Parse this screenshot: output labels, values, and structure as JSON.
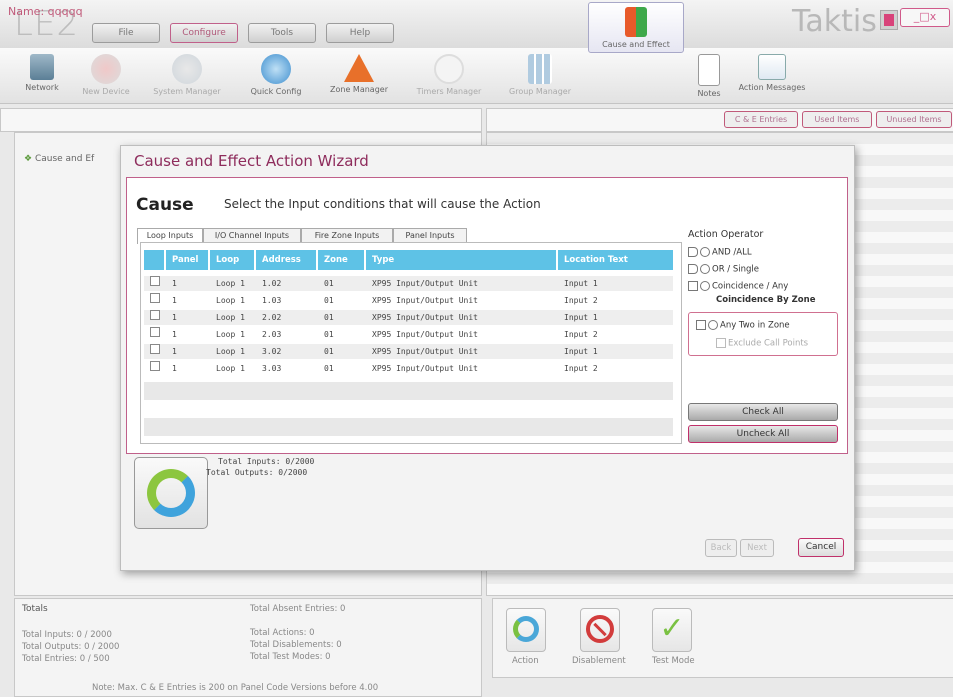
{
  "app": {
    "logo": "LE2",
    "brand": "Taktis",
    "window_controls": "_□x"
  },
  "menu": [
    "File",
    "Configure",
    "Tools",
    "Help"
  ],
  "toolbar": [
    {
      "label": "Network",
      "icon": "network-icon",
      "enabled": true
    },
    {
      "label": "New Device",
      "icon": "new-device-icon",
      "enabled": false
    },
    {
      "label": "System Manager",
      "icon": "system-manager-icon",
      "enabled": false
    },
    {
      "label": "Quick Config",
      "icon": "quick-config-icon",
      "enabled": true
    },
    {
      "label": "Zone Manager",
      "icon": "zone-manager-icon",
      "enabled": true
    },
    {
      "label": "Timers Manager",
      "icon": "timers-manager-icon",
      "enabled": false
    },
    {
      "label": "Group Manager",
      "icon": "group-manager-icon",
      "enabled": false
    },
    {
      "label": "Cause and Effect",
      "icon": "cause-and-effect-icon",
      "enabled": true,
      "selected": true
    },
    {
      "label": "Notes",
      "icon": "notes-icon",
      "enabled": true
    },
    {
      "label": "Action Messages",
      "icon": "action-messages-icon",
      "enabled": true
    }
  ],
  "name_row": {
    "label": "Name: qqqqq"
  },
  "right_tabs": [
    "C & E Entries",
    "Used Items",
    "Unused Items"
  ],
  "tree": {
    "item": "Cause and Ef"
  },
  "totals": {
    "title": "Totals",
    "inputs": "Total Inputs: 0 / 2000",
    "outputs": "Total Outputs: 0 / 2000",
    "entries": "Total Entries: 0 / 500",
    "absent": "Total Absent Entries: 0",
    "actions": "Total Actions: 0",
    "disablements": "Total Disablements: 0",
    "test_modes": "Total Test Modes: 0",
    "note": "Note: Max. C & E Entries is 200 on Panel Code Versions before 4.00"
  },
  "bottom_actions": [
    {
      "label": "Action",
      "icon": "action-icon"
    },
    {
      "label": "Disablement",
      "icon": "disablement-icon"
    },
    {
      "label": "Test Mode",
      "icon": "test-mode-icon"
    }
  ],
  "wizard": {
    "title": "Cause and Effect Action Wizard",
    "heading": "Cause",
    "subheading": "Select the Input conditions that will cause the Action",
    "tabs": [
      "Loop Inputs",
      "I/O Channel Inputs",
      "Fire Zone Inputs",
      "Panel Inputs"
    ],
    "columns": [
      "Panel",
      "Loop",
      "Address",
      "Zone",
      "Type",
      "Location Text"
    ],
    "rows": [
      [
        "1",
        "Loop 1",
        "1.02",
        "01",
        "XP95 Input/Output Unit",
        "Input 1"
      ],
      [
        "1",
        "Loop 1",
        "1.03",
        "01",
        "XP95 Input/Output Unit",
        "Input 2"
      ],
      [
        "1",
        "Loop 1",
        "2.02",
        "01",
        "XP95 Input/Output Unit",
        "Input 1"
      ],
      [
        "1",
        "Loop 1",
        "2.03",
        "01",
        "XP95 Input/Output Unit",
        "Input 2"
      ],
      [
        "1",
        "Loop 1",
        "3.02",
        "01",
        "XP95 Input/Output Unit",
        "Input 1"
      ],
      [
        "1",
        "Loop 1",
        "3.03",
        "01",
        "XP95 Input/Output Unit",
        "Input 2"
      ]
    ],
    "operator": {
      "title": "Action Operator",
      "and_all": "AND /ALL",
      "or_single": "OR / Single",
      "coincidence": "Coincidence / Any",
      "coincidence_by_zone": "Coincidence By Zone",
      "any_two_in_zone": "Any Two in Zone",
      "exclude_call_points": "Exclude Call Points"
    },
    "check_all": "Check All",
    "uncheck_all": "Uncheck All",
    "total_inputs": "Total Inputs: 0/2000",
    "total_outputs": "Total Outputs: 0/2000",
    "back": "Back",
    "next": "Next",
    "cancel": "Cancel"
  }
}
